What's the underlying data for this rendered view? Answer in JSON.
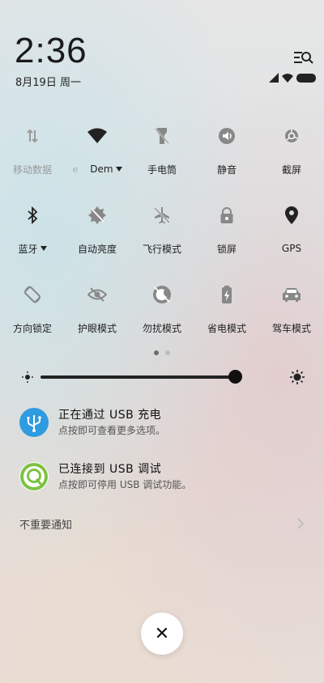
{
  "header": {
    "time": "2:36",
    "date": "8月19日 周一"
  },
  "tiles": [
    [
      {
        "label": "移动数据",
        "icon": "mobile-data-icon",
        "dim": true
      },
      {
        "label": "Dem",
        "icon": "wifi-icon",
        "caret": true,
        "prefix": "e"
      },
      {
        "label": "手电筒",
        "icon": "flashlight-icon"
      },
      {
        "label": "静音",
        "icon": "volume-icon"
      },
      {
        "label": "截屏",
        "icon": "screenshot-icon"
      }
    ],
    [
      {
        "label": "蓝牙",
        "icon": "bluetooth-icon",
        "caret": true
      },
      {
        "label": "自动亮度",
        "icon": "auto-brightness-icon"
      },
      {
        "label": "飞行模式",
        "icon": "airplane-icon"
      },
      {
        "label": "锁屏",
        "icon": "lock-icon"
      },
      {
        "label": "GPS",
        "icon": "location-icon"
      }
    ],
    [
      {
        "label": "方向锁定",
        "icon": "rotation-lock-icon"
      },
      {
        "label": "护眼模式",
        "icon": "eye-care-icon"
      },
      {
        "label": "勿扰模式",
        "icon": "do-not-disturb-icon"
      },
      {
        "label": "省电模式",
        "icon": "battery-saver-icon"
      },
      {
        "label": "驾车模式",
        "icon": "car-icon"
      }
    ]
  ],
  "notifications": [
    {
      "title": "正在通过 USB 充电",
      "subtitle": "点按即可查看更多选项。",
      "icon": "usb-icon",
      "color": "#2f9be0"
    },
    {
      "title": "已连接到 USB 调试",
      "subtitle": "点按即可停用 USB 调试功能。",
      "icon": "android-debug-icon",
      "color": "#7dc242"
    }
  ],
  "unimportant": "不重要通知",
  "close_symbol": "✕"
}
